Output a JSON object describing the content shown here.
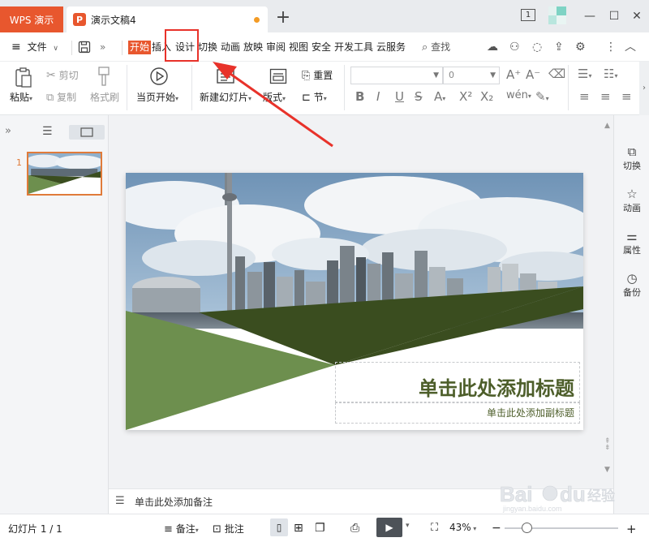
{
  "titlebar": {
    "app_tab": "WPS 演示",
    "doc_tab": "演示文稿4",
    "doc_icon_letter": "P",
    "new_tab": "+",
    "window_count": "1",
    "minimize": "—",
    "maximize": "☐",
    "close": "✕"
  },
  "menubar": {
    "file": "文件",
    "tabs": [
      "开始",
      "插入",
      "设计",
      "切换",
      "动画",
      "放映",
      "审阅",
      "视图",
      "安全",
      "开发工具",
      "云服务"
    ],
    "search": "查找"
  },
  "ribbon": {
    "paste": "粘贴",
    "cut": "剪切",
    "copy": "复制",
    "format_painter": "格式刷",
    "from_current": "当页开始",
    "new_slide": "新建幻灯片",
    "layout": "版式",
    "reset": "重置",
    "section": "节",
    "font_size": "0",
    "bold": "B",
    "italic": "I",
    "underline": "U",
    "strike": "S"
  },
  "slide": {
    "number": "1",
    "title_placeholder": "单击此处添加标题",
    "subtitle_placeholder": "单击此处添加副标题"
  },
  "notes": {
    "placeholder": "单击此处添加备注"
  },
  "rightpanel": {
    "items": [
      "切换",
      "动画",
      "属性",
      "备份"
    ]
  },
  "statusbar": {
    "slide_count": "幻灯片 1 / 1",
    "notes": "备注",
    "comments": "批注",
    "zoom": "43%"
  },
  "watermark": {
    "brand": "Bai du 经验",
    "url": "jingyan.baidu.com"
  },
  "colors": {
    "accent": "#e8572e",
    "title_green": "#4d5e2a",
    "dark_green": "#3a4d1f",
    "light_green": "#6d8f4e",
    "annotation_red": "#e8322a"
  }
}
